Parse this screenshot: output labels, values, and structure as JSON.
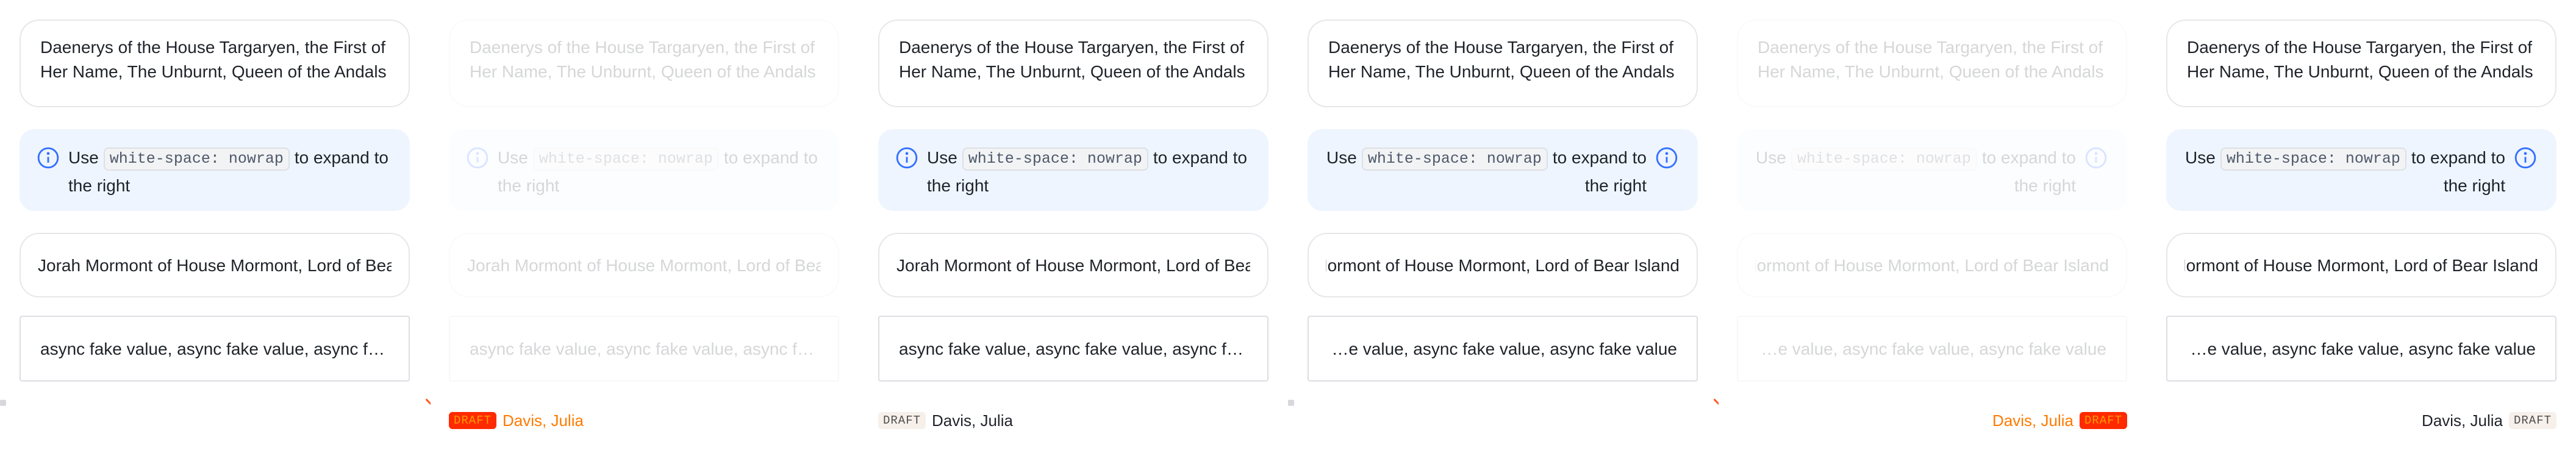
{
  "ellipsis_text": "Daenerys of the House Targaryen, the First of Her Name, The Unburnt, Queen of the Andals",
  "callout": {
    "prefix": "Use",
    "code": "white-space: nowrap",
    "suffix": "to expand to the right",
    "icon": "info-icon",
    "accent": "#3370ff"
  },
  "single_text": "Jorah Mormont of House Mormont, Lord of Bear Island",
  "async_text": "async fake value, async fake value, async fake value",
  "footer": {
    "badge": "DRAFT",
    "author": "Davis, Julia"
  },
  "colors": {
    "callout_bg": "#eef5ff",
    "border": "#e6e7ea",
    "badge_bg": "#f7f0ea",
    "hot_badge_bg": "#ff2a00",
    "hot_text": "#ff7a00"
  }
}
